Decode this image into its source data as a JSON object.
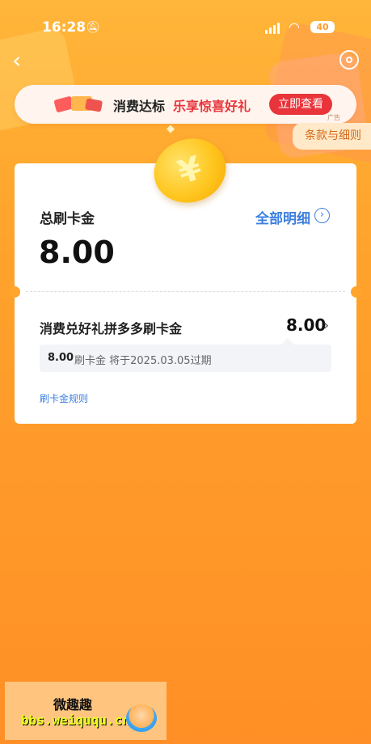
{
  "status_bar": {
    "time": "16:28",
    "battery": "40"
  },
  "banner": {
    "text_black": "消费达标",
    "text_red": "乐享惊喜好礼",
    "button": "立即查看",
    "ad_tag": "广告"
  },
  "terms_tab": "条款与细则",
  "summary": {
    "label": "总刷卡金",
    "detail_link": "全部明细",
    "amount": "8.00"
  },
  "item": {
    "label": "消费兑好礼拼多多刷卡金",
    "value": "8.00",
    "expire_amount": "8.00",
    "expire_text": "刷卡金 将于2025.03.05过期"
  },
  "rules_link": "刷卡金规则",
  "watermark": {
    "title": "微趣趣",
    "url": "bbs.weiququ.cn"
  },
  "colors": {
    "accent": "#ffa42c",
    "link": "#3d7fe0",
    "banner_red": "#e8343a"
  },
  "icons": [
    "bell-slash-icon",
    "signal-icon",
    "wifi-icon",
    "back-icon",
    "headset-icon",
    "coin-icon",
    "chevron-right-icon"
  ]
}
